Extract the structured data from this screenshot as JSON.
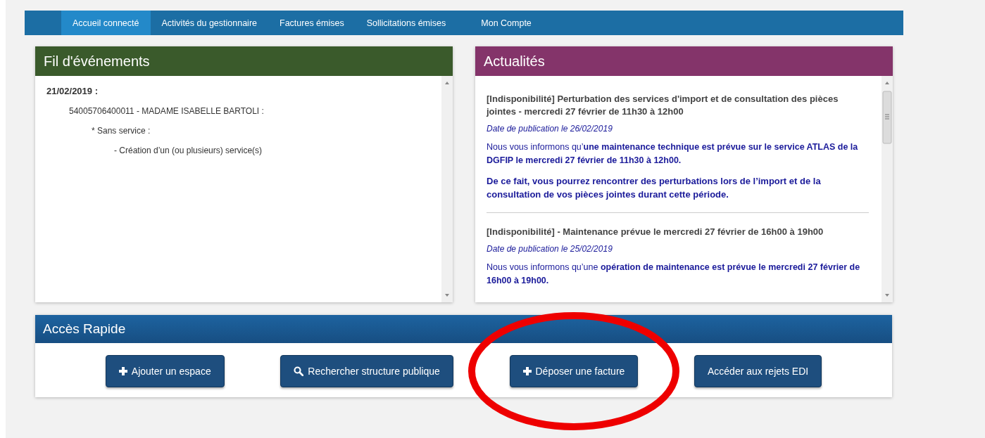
{
  "nav": {
    "tabs": [
      {
        "label": "Accueil connecté",
        "selected": true
      },
      {
        "label": "Activités du gestionnaire",
        "selected": false
      },
      {
        "label": "Factures émises",
        "selected": false
      },
      {
        "label": "Sollicitations émises",
        "selected": false
      },
      {
        "label": "Mon Compte",
        "selected": false
      }
    ]
  },
  "events_panel": {
    "title": "Fil d'événements",
    "entries": [
      {
        "text": "21/02/2019 :",
        "children": [
          {
            "text": "54005706400011 - MADAME ISABELLE BARTOLI :",
            "children": [
              {
                "text": "* Sans service :",
                "children": [
                  {
                    "text": "- Création d’un (ou plusieurs) service(s)"
                  }
                ]
              }
            ]
          }
        ]
      }
    ]
  },
  "news_panel": {
    "title": "Actualités",
    "items": [
      {
        "title": "[Indisponibilité] Perturbation des services d'import et de consultation des pièces jointes - mercredi 27 février de 11h30 à 12h00",
        "date": "Date de publication le 26/02/2019",
        "paragraphs": [
          {
            "text": "Nous vous informons qu’**une maintenance technique est prévue sur le service ATLAS de la DGFIP le mercredi 27 février de 11h30 à 12h00.**",
            "bold": false
          },
          {
            "text": "De ce fait, vous pourrez rencontrer des perturbations lors de l’import et de la consultation de vos pièces jointes durant cette période.",
            "bold": true
          }
        ]
      },
      {
        "title": "[Indisponibilité] - Maintenance prévue le mercredi 27 février de 16h00 à 19h00",
        "date": "Date de publication le 25/02/2019",
        "paragraphs": [
          {
            "text": "Nous vous informons qu’une **opération de maintenance est prévue le mercredi 27 février de 16h00 à 19h00.**",
            "bold": false
          }
        ]
      }
    ]
  },
  "quick_access": {
    "title": "Accès Rapide",
    "buttons": [
      {
        "label": "Ajouter un espace",
        "kind": "plus",
        "highlighted": false
      },
      {
        "label": "Rechercher structure publique",
        "kind": "search",
        "highlighted": false
      },
      {
        "label": "Déposer une facture",
        "kind": "plus",
        "highlighted": true
      },
      {
        "label": "Accéder aux rejets EDI",
        "kind": "text",
        "highlighted": false
      }
    ]
  }
}
